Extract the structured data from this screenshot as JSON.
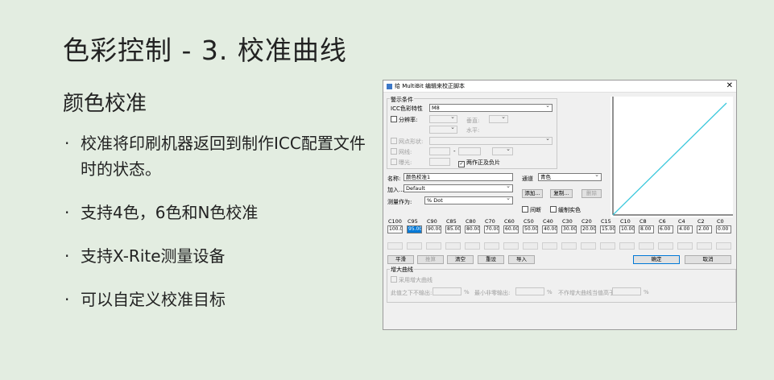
{
  "slide": {
    "title": "色彩控制 - 3. 校准曲线",
    "subtitle": "颜色校准",
    "bullet_symbol": "·",
    "bullets": [
      "校准将印刷机器返回到制作ICC配置文件时的状态。",
      "支持4色，6色和N色校准",
      "支持X-Rite测量设备",
      "可以自定义校准目标"
    ]
  },
  "dialog": {
    "title": "给 MultiBit 编辑来校正脚本",
    "close_glyph": "✕",
    "display_group": {
      "label": "警示条件",
      "icc_label": "ICC色彩特性",
      "icc_value": "M8",
      "resolution_label": "分辨率:",
      "vertical_label": "垂直:",
      "horizontal_label": "水平:",
      "screen_shape_label": "网点形状:",
      "screen_label": "网线:",
      "screen_dash": "-",
      "exposure_label": "曝光:",
      "both_sides_label": "两作正及负片",
      "both_sides_check": "✓"
    },
    "name_label": "名称:",
    "name_value": "颜色校准1",
    "load_label": "加入...",
    "load_value": "Default",
    "measure_label": "测量作为:",
    "measure_value": "% Dot",
    "channel_label": "通道",
    "channel_value": "青色",
    "add_button": "添加...",
    "copy_button": "复制...",
    "delete_button": "删除",
    "interrupt_label": "间断",
    "solid_label": "缓制实色",
    "curve_labels": [
      "C100",
      "C95",
      "C90",
      "C85",
      "C80",
      "C70",
      "C60",
      "C50",
      "C40",
      "C30",
      "C20",
      "C15",
      "C10",
      "C8",
      "C6",
      "C4",
      "C2",
      "C0"
    ],
    "curve_values": [
      "100.00",
      "95.00",
      "90.00",
      "85.00",
      "80.00",
      "70.00",
      "60.00",
      "50.00",
      "40.00",
      "30.00",
      "20.00",
      "15.00",
      "10.00",
      "8.00",
      "6.00",
      "4.00",
      "2.00",
      "0.00"
    ],
    "buttons": {
      "smooth": "平滑",
      "calc": "推算",
      "clear": "清空",
      "reset": "重设",
      "import": "导入",
      "ok": "确定",
      "cancel": "取消"
    },
    "max_curve": {
      "group_label": "增大曲线",
      "use_label": "采用增大曲线",
      "below_label": "此值之下不输出:",
      "min_output_label": "最小非零输出:",
      "no_output_label": "不作增大曲线当值高于:",
      "percent": "%"
    }
  }
}
